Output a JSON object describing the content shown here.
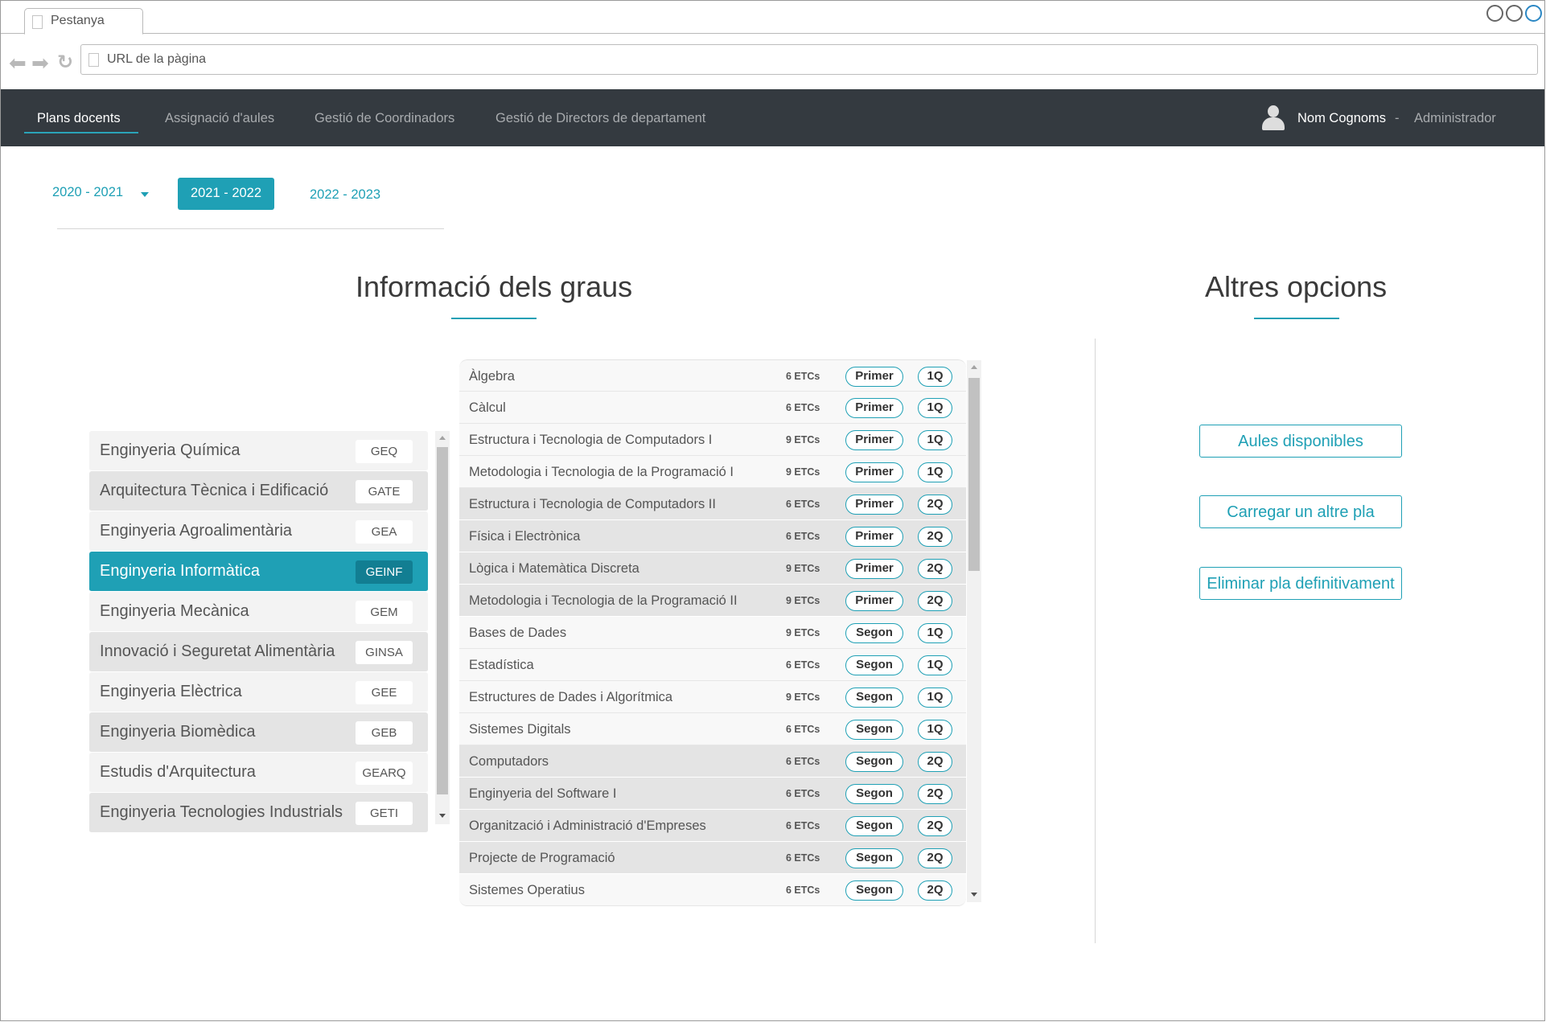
{
  "browser": {
    "tab_title": "Pestanya",
    "url": "URL de la pàgina"
  },
  "nav": {
    "items": [
      "Plans docents",
      "Assignació d'aules",
      "Gestió de Coordinadors",
      "Gestió de Directors de departament"
    ],
    "active": "Plans docents",
    "user_name": "Nom Cognoms",
    "separator": "-",
    "user_role": "Administrador"
  },
  "years": {
    "prev": "2020 - 2021",
    "current": "2021 - 2022",
    "next": "2022 - 2023"
  },
  "sections": {
    "degrees_title": "Informació dels graus",
    "options_title": "Altres opcions"
  },
  "degrees": [
    {
      "name": "Enginyeria Química",
      "code": "GEQ"
    },
    {
      "name": "Arquitectura Tècnica i Edificació",
      "code": "GATE"
    },
    {
      "name": "Enginyeria Agroalimentària",
      "code": "GEA"
    },
    {
      "name": "Enginyeria Informàtica",
      "code": "GEINF",
      "selected": true
    },
    {
      "name": "Enginyeria Mecànica",
      "code": "GEM"
    },
    {
      "name": "Innovació i Seguretat Alimentària",
      "code": "GINSA"
    },
    {
      "name": "Enginyeria Elèctrica",
      "code": "GEE"
    },
    {
      "name": "Enginyeria Biomèdica",
      "code": "GEB"
    },
    {
      "name": "Estudis d'Arquitectura",
      "code": "GEARQ"
    },
    {
      "name": "Enginyeria Tecnologies Industrials",
      "code": "GETI"
    }
  ],
  "subjects": [
    {
      "name": "Àlgebra",
      "etcs": "6 ETCs",
      "year": "Primer",
      "quad": "1Q"
    },
    {
      "name": "Càlcul",
      "etcs": "6 ETCs",
      "year": "Primer",
      "quad": "1Q"
    },
    {
      "name": "Estructura i Tecnologia de Computadors I",
      "etcs": "9 ETCs",
      "year": "Primer",
      "quad": "1Q"
    },
    {
      "name": "Metodologia i Tecnologia de la Programació I",
      "etcs": "9 ETCs",
      "year": "Primer",
      "quad": "1Q"
    },
    {
      "name": "Estructura i Tecnologia de Computadors II",
      "etcs": "6 ETCs",
      "year": "Primer",
      "quad": "2Q"
    },
    {
      "name": "Física i Electrònica",
      "etcs": "6 ETCs",
      "year": "Primer",
      "quad": "2Q"
    },
    {
      "name": "Lògica i Matemàtica Discreta",
      "etcs": "9 ETCs",
      "year": "Primer",
      "quad": "2Q"
    },
    {
      "name": "Metodologia i Tecnologia de la Programació II",
      "etcs": "9 ETCs",
      "year": "Primer",
      "quad": "2Q"
    },
    {
      "name": "Bases de Dades",
      "etcs": "9 ETCs",
      "year": "Segon",
      "quad": "1Q"
    },
    {
      "name": "Estadística",
      "etcs": "6 ETCs",
      "year": "Segon",
      "quad": "1Q"
    },
    {
      "name": "Estructures de Dades i Algorítmica",
      "etcs": "9 ETCs",
      "year": "Segon",
      "quad": "1Q"
    },
    {
      "name": "Sistemes Digitals",
      "etcs": "6 ETCs",
      "year": "Segon",
      "quad": "1Q"
    },
    {
      "name": "Computadors",
      "etcs": "6 ETCs",
      "year": "Segon",
      "quad": "2Q"
    },
    {
      "name": "Enginyeria del Software I",
      "etcs": "6 ETCs",
      "year": "Segon",
      "quad": "2Q"
    },
    {
      "name": "Organització i Administració d'Empreses",
      "etcs": "6 ETCs",
      "year": "Segon",
      "quad": "2Q"
    },
    {
      "name": "Projecte de Programació",
      "etcs": "6 ETCs",
      "year": "Segon",
      "quad": "2Q"
    },
    {
      "name": "Sistemes Operatius",
      "etcs": "6 ETCs",
      "year": "Segon",
      "quad": "2Q"
    }
  ],
  "options": {
    "available_rooms": "Aules disponibles",
    "load_plan": "Carregar un altre pla",
    "delete_plan": "Eliminar pla definitivament"
  },
  "colors": {
    "accent": "#1fa0b5",
    "navbar": "#343a40"
  }
}
